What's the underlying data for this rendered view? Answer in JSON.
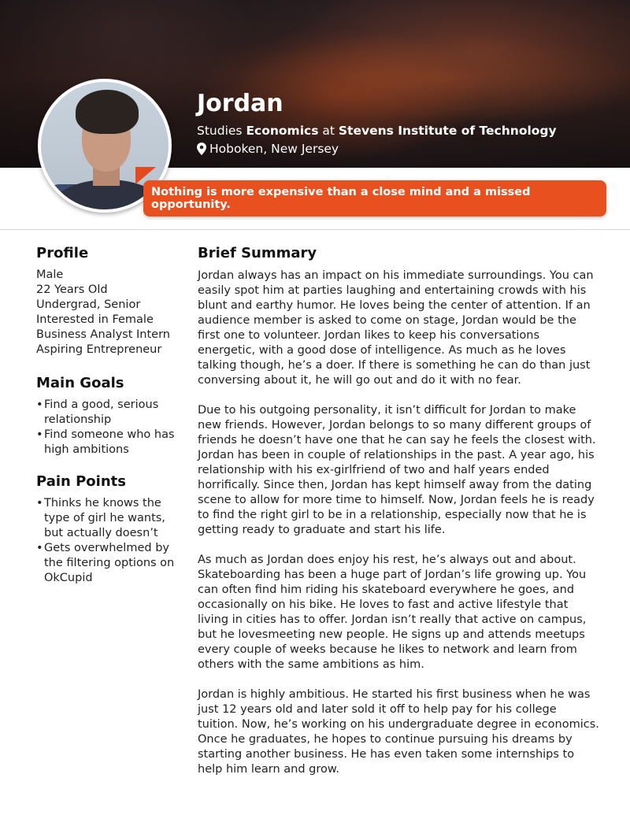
{
  "header": {
    "name": "Jordan",
    "studies_prefix": "Studies ",
    "major": "Economics",
    "studies_mid": " at ",
    "school": "Stevens Institute of Technology",
    "location": "Hoboken, New Jersey",
    "location_icon": "location-pin-icon"
  },
  "quote": "Nothing is more expensive than a close mind and a missed opportunity.",
  "profile": {
    "heading": "Profile",
    "items": [
      "Male",
      "22 Years Old",
      "Undergrad, Senior",
      "Interested in Female",
      "Business Analyst Intern",
      "Aspiring Entrepreneur"
    ]
  },
  "goals": {
    "heading": "Main Goals",
    "items": [
      "Find a good, serious relationship",
      "Find someone who has high ambitions"
    ]
  },
  "pain_points": {
    "heading": "Pain Points",
    "items": [
      "Thinks he knows the type of girl he wants, but actually doesn’t",
      "Gets overwhelmed by the filtering options on OkCupid"
    ]
  },
  "summary": {
    "heading": "Brief Summary",
    "paragraphs": [
      "Jordan always has an impact on his immediate surroundings. You can easily spot him at parties laughing and entertaining crowds with his blunt and earthy humor. He loves being the center of attention. If an audience member is asked to come on stage, Jordan would be the first one to volunteer. Jordan likes to keep his conversations energetic, with a good dose of intelligence. As much as he loves talking though, he’s a doer. If there is something he can do than just conversing about it, he will go out and do it with no fear.",
      "Due to his outgoing personality, it isn’t difficult for Jordan to make new friends. However, Jordan belongs to so many different groups of friends he doesn’t have one that he can say he feels the closest with. Jordan has been in couple of relationships in the past. A year ago, his relationship with his ex-girlfriend of two and half years ended horrifically. Since then, Jordan has kept himself away from the dating scene to allow for more time to himself. Now, Jordan feels he is ready to find the right girl to be in a relationship, especially now that he is getting ready to graduate and start his life.",
      "As much as Jordan does enjoy his rest, he’s always out and about. Skateboarding has been a huge part of Jordan’s life growing up. You can often find him riding his skateboard everywhere he goes, and occasionally on his bike. He loves to fast and active lifestyle that living in cities has to offer. Jordan isn’t really that active on campus, but he lovesmeeting new people. He signs up and attends meetups every couple of weeks because he likes to network and learn from others with the same ambitions as him.",
      "Jordan is highly ambitious. He started his first business when he was just 12 years old and later sold it off to help pay for his college tuition. Now, he’s working on his undergraduate degree in economics. Once he graduates, he hopes to continue pursuing his dreams  by starting another business. He has even taken some internships to help him learn and grow."
    ]
  },
  "colors": {
    "accent": "#e8501f",
    "text": "#222222"
  }
}
